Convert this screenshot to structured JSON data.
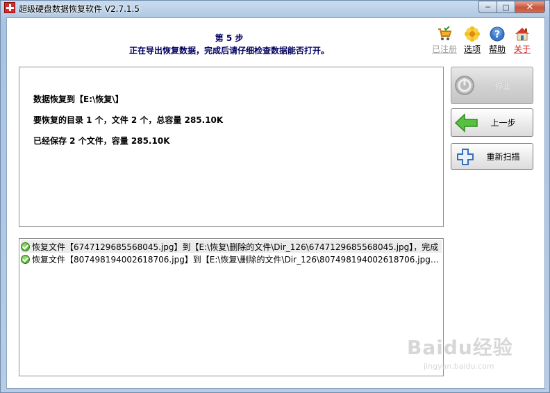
{
  "window": {
    "title": "超级硬盘数据恢复软件 V2.7.1.5",
    "minimize": "─",
    "maximize": "□",
    "close": "✕"
  },
  "header": {
    "step_title": "第 5 步",
    "step_desc": "正在导出恢复数据，完成后请仔细检查数据能否打开。"
  },
  "toolbar": {
    "registered": "已注册",
    "options": "选项",
    "help": "帮助",
    "about": "关于"
  },
  "info": {
    "line1": "数据恢复到【E:\\恢复\\】",
    "line2": "要恢复的目录 1 个，文件 2 个，总容量 285.10K",
    "line3": "已经保存 2 个文件，容量 285.10K"
  },
  "buttons": {
    "stop": "停止",
    "prev": "上一步",
    "rescan": "重新扫描"
  },
  "log": [
    "恢复文件【6747129685568045.jpg】到【E:\\恢复\\删除的文件\\Dir_126\\6747129685568045.jpg】，完成",
    "恢复文件【807498194002618706.jpg】到【E:\\恢复\\删除的文件\\Dir_126\\807498194002618706.jpg】，..."
  ],
  "watermark": {
    "main": "Baidu经验",
    "sub": "jingyan.baidu.com"
  },
  "colors": {
    "header_text": "#000060",
    "about_link": "#d02020",
    "registered_link": "#a0a0a0"
  }
}
